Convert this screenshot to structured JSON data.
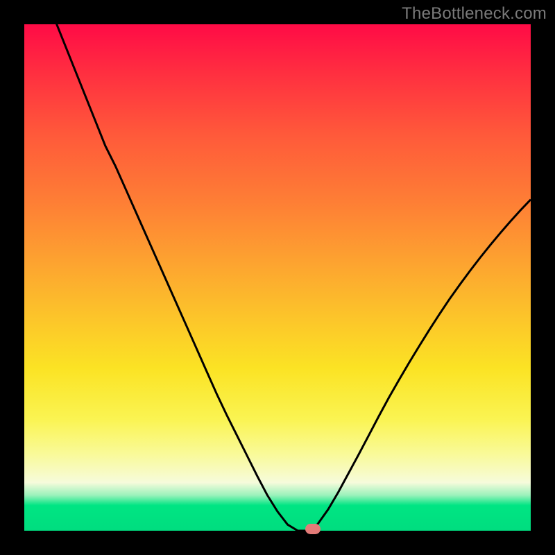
{
  "attribution": "TheBottleneck.com",
  "colors": {
    "page_bg": "#000000",
    "attribution_text": "#7a7a7a",
    "curve_stroke": "#000000",
    "marker_fill": "#e37b78",
    "gradient_stops": [
      "#ff0b46",
      "#ff3040",
      "#ff5a3a",
      "#fe7e35",
      "#fda330",
      "#fcc52a",
      "#fbe324",
      "#faf452",
      "#f9fa9a",
      "#f6fbdb",
      "#9af2bb",
      "#00e583",
      "#00dd7f"
    ]
  },
  "chart_data": {
    "type": "line",
    "title": "",
    "xlabel": "",
    "ylabel": "",
    "xlim": [
      0,
      100
    ],
    "ylim": [
      0,
      100
    ],
    "grid": false,
    "legend": false,
    "x": [
      0,
      2,
      4,
      6,
      8,
      10,
      12,
      14,
      16,
      18,
      20,
      22,
      24,
      26,
      28,
      30,
      32,
      34,
      36,
      38,
      40,
      42,
      44,
      46,
      48,
      50,
      52,
      54,
      55,
      56,
      57,
      58,
      60,
      62,
      64,
      66,
      68,
      70,
      72,
      74,
      76,
      78,
      80,
      82,
      84,
      86,
      88,
      90,
      92,
      94,
      96,
      98,
      100
    ],
    "values": [
      118,
      112,
      106,
      101,
      96,
      91,
      86,
      81,
      76,
      72,
      67.5,
      63,
      58.5,
      54,
      49.5,
      45,
      40.5,
      36,
      31.5,
      27,
      22.8,
      18.8,
      14.8,
      10.8,
      7,
      3.8,
      1.2,
      0,
      0,
      0,
      0.3,
      1.4,
      4.2,
      7.6,
      11.3,
      15,
      18.8,
      22.6,
      26.3,
      29.8,
      33.2,
      36.5,
      39.7,
      42.8,
      45.8,
      48.6,
      51.3,
      53.9,
      56.4,
      58.8,
      61.1,
      63.3,
      65.4
    ],
    "marker_position": {
      "x": 57,
      "y": 0
    },
    "notes": "Synthetic bottleneck V-curve; values read off image pixels, approximate to ±2."
  }
}
